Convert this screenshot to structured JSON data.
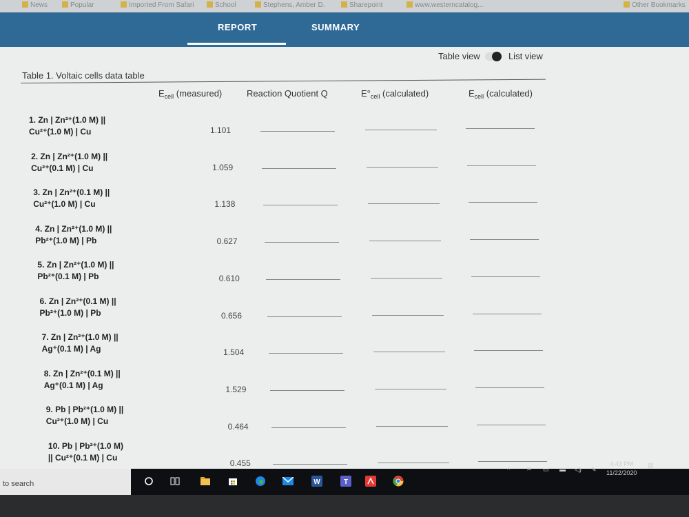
{
  "bookmarks": [
    "News",
    "Popular",
    "Imported From Safari",
    "School",
    "Stephens, Amber D.",
    "Sharepoint",
    "www.westerncatalog...",
    "Other Bookmarks"
  ],
  "tabs": {
    "report": "REPORT",
    "summary": "SUMMARY"
  },
  "view_toggle": {
    "table": "Table view",
    "list": "List view"
  },
  "table": {
    "title": "Table 1. Voltaic cells data table",
    "headers": {
      "e_meas_main": "E",
      "e_meas_sub": "cell",
      "e_meas_rest": " (measured)",
      "q": "Reaction Quotient Q",
      "e0_main": "E°",
      "e0_sub": "cell",
      "e0_rest": " (calculated)",
      "ecalc_main": "E",
      "ecalc_sub": "cell",
      "ecalc_rest": " (calculated)"
    },
    "rows": [
      {
        "line1": "1. Zn | Zn²⁺(1.0 M) ||",
        "line2": "Cu²⁺(1.0 M) | Cu",
        "value": "1.101"
      },
      {
        "line1": "2. Zn | Zn²⁺(1.0 M) ||",
        "line2": "Cu²⁺(0.1 M) | Cu",
        "value": "1.059"
      },
      {
        "line1": "3. Zn | Zn²⁺(0.1 M) ||",
        "line2": "Cu²⁺(1.0 M) | Cu",
        "value": "1.138"
      },
      {
        "line1": "4. Zn | Zn²⁺(1.0 M) ||",
        "line2": "Pb²⁺(1.0 M) | Pb",
        "value": "0.627"
      },
      {
        "line1": "5. Zn | Zn²⁺(1.0 M) ||",
        "line2": "Pb²⁺(0.1 M) | Pb",
        "value": "0.610"
      },
      {
        "line1": "6. Zn | Zn²⁺(0.1 M) ||",
        "line2": "Pb²⁺(1.0 M) | Pb",
        "value": "0.656"
      },
      {
        "line1": "7. Zn | Zn²⁺(1.0 M) ||",
        "line2": "Ag⁺(0.1 M) | Ag",
        "value": "1.504"
      },
      {
        "line1": "8. Zn | Zn²⁺(0.1 M) ||",
        "line2": "Ag⁺(0.1 M) | Ag",
        "value": "1.529"
      },
      {
        "line1": "9. Pb | Pb²⁺(1.0 M) ||",
        "line2": "Cu²⁺(1.0 M) | Cu",
        "value": "0.464"
      },
      {
        "line1": "10. Pb | Pb²⁺(1.0 M)",
        "line2": "|| Cu²⁺(0.1 M) | Cu",
        "value": "0.455"
      }
    ]
  },
  "taskbar": {
    "search_placeholder": "to search",
    "time": "4:43 PM",
    "date": "11/22/2020"
  },
  "icons": [
    "search-icon",
    "task-view-icon",
    "file-explorer-icon",
    "store-icon",
    "edge-icon",
    "mail-icon",
    "word-icon",
    "teams-icon",
    "acrobat-icon",
    "chrome-icon"
  ]
}
